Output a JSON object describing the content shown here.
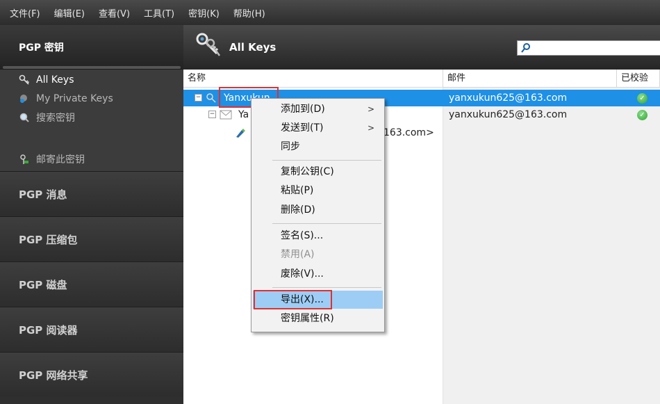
{
  "menubar": {
    "items": [
      "文件(F)",
      "编辑(E)",
      "查看(V)",
      "工具(T)",
      "密钥(K)",
      "帮助(H)"
    ]
  },
  "sidebar": {
    "header": "PGP 密钥",
    "items": [
      {
        "label": "All Keys",
        "icon": "keys-icon",
        "active": true
      },
      {
        "label": "My Private Keys",
        "icon": "private-key-icon",
        "active": false
      },
      {
        "label": "搜索密钥",
        "icon": "search-icon",
        "active": false
      },
      {
        "label": "邮寄此密钥",
        "icon": "mail-key-icon",
        "active": false
      }
    ],
    "sections": [
      "PGP 消息",
      "PGP 压缩包",
      "PGP 磁盘",
      "PGP 阅读器",
      "PGP 网络共享"
    ]
  },
  "main": {
    "title": "All Keys",
    "search_placeholder": ""
  },
  "table": {
    "columns": [
      "名称",
      "邮件",
      "已校验"
    ],
    "rows": [
      {
        "name": "Yanxukun",
        "email": "yanxukun625@163.com",
        "verified": true,
        "selected": true
      },
      {
        "name": "Ya",
        "email": "yanxukun625@163.com",
        "verified": true,
        "selected": false
      },
      {
        "name": "163.com>",
        "email": "",
        "verified": false,
        "selected": false
      }
    ]
  },
  "context_menu": {
    "items": [
      {
        "label": "添加到(D)",
        "submenu": true
      },
      {
        "label": "发送到(T)",
        "submenu": true
      },
      {
        "label": "同步",
        "submenu": false
      },
      {
        "label": "复制公钥(C)",
        "submenu": false
      },
      {
        "label": "粘贴(P)",
        "submenu": false
      },
      {
        "label": "删除(D)",
        "submenu": false
      },
      {
        "label": "签名(S)...",
        "submenu": false
      },
      {
        "label": "禁用(A)",
        "submenu": false,
        "disabled": true
      },
      {
        "label": "废除(V)...",
        "submenu": false
      },
      {
        "label": "导出(X)...",
        "submenu": false,
        "highlighted": true
      },
      {
        "label": "密钥属性(R)",
        "submenu": false
      }
    ]
  },
  "colors": {
    "selection": "#1e90e6",
    "menu_highlight": "#9dcdf5",
    "annotation_red": "#e03030"
  }
}
